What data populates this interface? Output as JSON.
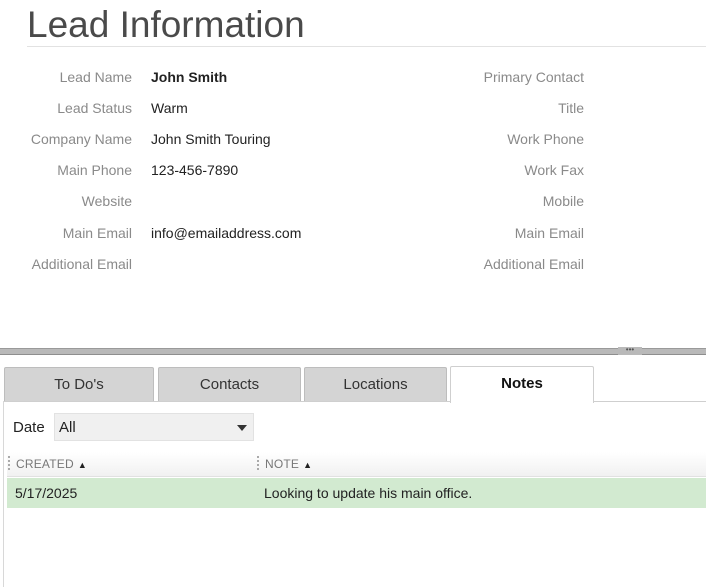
{
  "header": {
    "title": "Lead Information"
  },
  "lead": [
    {
      "label": "Lead Name",
      "value": "John Smith",
      "bold": true
    },
    {
      "label": "Lead Status",
      "value": "Warm"
    },
    {
      "label": "Company Name",
      "value": "John Smith Touring"
    },
    {
      "label": "Main Phone",
      "value": "123-456-7890"
    },
    {
      "label": "Website",
      "value": ""
    },
    {
      "label": "Main Email",
      "value": "info@emailaddress.com"
    },
    {
      "label": "Additional Email",
      "value": ""
    }
  ],
  "contact": [
    {
      "label": "Primary Contact",
      "value": ""
    },
    {
      "label": "Title",
      "value": ""
    },
    {
      "label": "Work Phone",
      "value": ""
    },
    {
      "label": "Work Fax",
      "value": ""
    },
    {
      "label": "Mobile",
      "value": ""
    },
    {
      "label": "Main Email",
      "value": ""
    },
    {
      "label": "Additional Email",
      "value": ""
    }
  ],
  "tabs": [
    {
      "label": "To Do's",
      "active": false
    },
    {
      "label": "Contacts",
      "active": false
    },
    {
      "label": "Locations",
      "active": false
    },
    {
      "label": "Notes",
      "active": true
    }
  ],
  "filter": {
    "label": "Date",
    "selected": "All"
  },
  "grid": {
    "columns": [
      {
        "label": "CREATED",
        "sort": "▲"
      },
      {
        "label": "NOTE",
        "sort": "▲"
      }
    ],
    "rows": [
      {
        "created": "5/17/2025",
        "note": "Looking to update his main office."
      }
    ],
    "selected_row_color": "#d2ead0"
  }
}
